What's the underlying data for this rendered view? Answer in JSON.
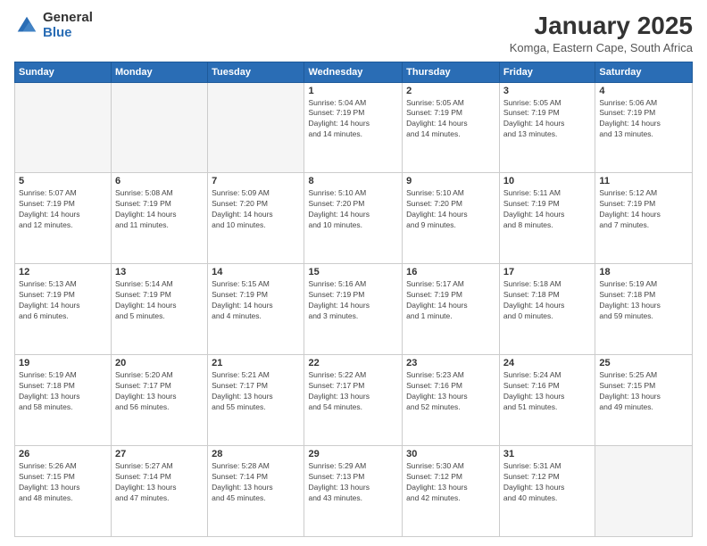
{
  "logo": {
    "general": "General",
    "blue": "Blue"
  },
  "title": "January 2025",
  "subtitle": "Komga, Eastern Cape, South Africa",
  "headers": [
    "Sunday",
    "Monday",
    "Tuesday",
    "Wednesday",
    "Thursday",
    "Friday",
    "Saturday"
  ],
  "weeks": [
    [
      {
        "day": "",
        "detail": ""
      },
      {
        "day": "",
        "detail": ""
      },
      {
        "day": "",
        "detail": ""
      },
      {
        "day": "1",
        "detail": "Sunrise: 5:04 AM\nSunset: 7:19 PM\nDaylight: 14 hours\nand 14 minutes."
      },
      {
        "day": "2",
        "detail": "Sunrise: 5:05 AM\nSunset: 7:19 PM\nDaylight: 14 hours\nand 14 minutes."
      },
      {
        "day": "3",
        "detail": "Sunrise: 5:05 AM\nSunset: 7:19 PM\nDaylight: 14 hours\nand 13 minutes."
      },
      {
        "day": "4",
        "detail": "Sunrise: 5:06 AM\nSunset: 7:19 PM\nDaylight: 14 hours\nand 13 minutes."
      }
    ],
    [
      {
        "day": "5",
        "detail": "Sunrise: 5:07 AM\nSunset: 7:19 PM\nDaylight: 14 hours\nand 12 minutes."
      },
      {
        "day": "6",
        "detail": "Sunrise: 5:08 AM\nSunset: 7:19 PM\nDaylight: 14 hours\nand 11 minutes."
      },
      {
        "day": "7",
        "detail": "Sunrise: 5:09 AM\nSunset: 7:20 PM\nDaylight: 14 hours\nand 10 minutes."
      },
      {
        "day": "8",
        "detail": "Sunrise: 5:10 AM\nSunset: 7:20 PM\nDaylight: 14 hours\nand 10 minutes."
      },
      {
        "day": "9",
        "detail": "Sunrise: 5:10 AM\nSunset: 7:20 PM\nDaylight: 14 hours\nand 9 minutes."
      },
      {
        "day": "10",
        "detail": "Sunrise: 5:11 AM\nSunset: 7:19 PM\nDaylight: 14 hours\nand 8 minutes."
      },
      {
        "day": "11",
        "detail": "Sunrise: 5:12 AM\nSunset: 7:19 PM\nDaylight: 14 hours\nand 7 minutes."
      }
    ],
    [
      {
        "day": "12",
        "detail": "Sunrise: 5:13 AM\nSunset: 7:19 PM\nDaylight: 14 hours\nand 6 minutes."
      },
      {
        "day": "13",
        "detail": "Sunrise: 5:14 AM\nSunset: 7:19 PM\nDaylight: 14 hours\nand 5 minutes."
      },
      {
        "day": "14",
        "detail": "Sunrise: 5:15 AM\nSunset: 7:19 PM\nDaylight: 14 hours\nand 4 minutes."
      },
      {
        "day": "15",
        "detail": "Sunrise: 5:16 AM\nSunset: 7:19 PM\nDaylight: 14 hours\nand 3 minutes."
      },
      {
        "day": "16",
        "detail": "Sunrise: 5:17 AM\nSunset: 7:19 PM\nDaylight: 14 hours\nand 1 minute."
      },
      {
        "day": "17",
        "detail": "Sunrise: 5:18 AM\nSunset: 7:18 PM\nDaylight: 14 hours\nand 0 minutes."
      },
      {
        "day": "18",
        "detail": "Sunrise: 5:19 AM\nSunset: 7:18 PM\nDaylight: 13 hours\nand 59 minutes."
      }
    ],
    [
      {
        "day": "19",
        "detail": "Sunrise: 5:19 AM\nSunset: 7:18 PM\nDaylight: 13 hours\nand 58 minutes."
      },
      {
        "day": "20",
        "detail": "Sunrise: 5:20 AM\nSunset: 7:17 PM\nDaylight: 13 hours\nand 56 minutes."
      },
      {
        "day": "21",
        "detail": "Sunrise: 5:21 AM\nSunset: 7:17 PM\nDaylight: 13 hours\nand 55 minutes."
      },
      {
        "day": "22",
        "detail": "Sunrise: 5:22 AM\nSunset: 7:17 PM\nDaylight: 13 hours\nand 54 minutes."
      },
      {
        "day": "23",
        "detail": "Sunrise: 5:23 AM\nSunset: 7:16 PM\nDaylight: 13 hours\nand 52 minutes."
      },
      {
        "day": "24",
        "detail": "Sunrise: 5:24 AM\nSunset: 7:16 PM\nDaylight: 13 hours\nand 51 minutes."
      },
      {
        "day": "25",
        "detail": "Sunrise: 5:25 AM\nSunset: 7:15 PM\nDaylight: 13 hours\nand 49 minutes."
      }
    ],
    [
      {
        "day": "26",
        "detail": "Sunrise: 5:26 AM\nSunset: 7:15 PM\nDaylight: 13 hours\nand 48 minutes."
      },
      {
        "day": "27",
        "detail": "Sunrise: 5:27 AM\nSunset: 7:14 PM\nDaylight: 13 hours\nand 47 minutes."
      },
      {
        "day": "28",
        "detail": "Sunrise: 5:28 AM\nSunset: 7:14 PM\nDaylight: 13 hours\nand 45 minutes."
      },
      {
        "day": "29",
        "detail": "Sunrise: 5:29 AM\nSunset: 7:13 PM\nDaylight: 13 hours\nand 43 minutes."
      },
      {
        "day": "30",
        "detail": "Sunrise: 5:30 AM\nSunset: 7:12 PM\nDaylight: 13 hours\nand 42 minutes."
      },
      {
        "day": "31",
        "detail": "Sunrise: 5:31 AM\nSunset: 7:12 PM\nDaylight: 13 hours\nand 40 minutes."
      },
      {
        "day": "",
        "detail": ""
      }
    ]
  ]
}
